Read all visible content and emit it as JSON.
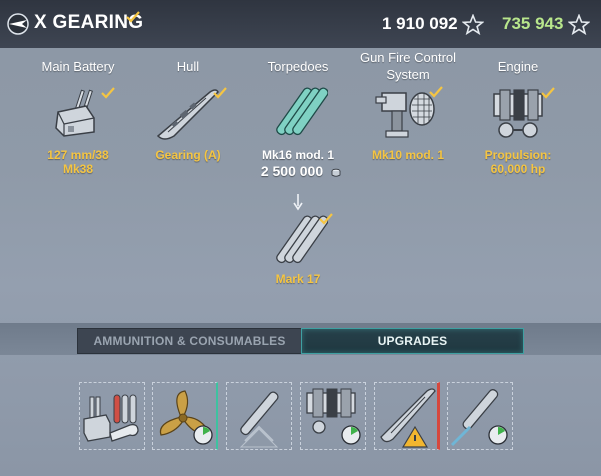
{
  "header": {
    "ship_title": "X GEARING",
    "xp_value": "1 910 092",
    "free_xp_value": "735 943",
    "colors": {
      "free_xp": "#b8e68c",
      "researched": "#f5c542"
    },
    "icons": [
      "nation-flag-icon",
      "researched-check-icon",
      "star-icon",
      "star-icon"
    ]
  },
  "modules": {
    "main_battery": {
      "title": "Main Battery",
      "name_line1": "127 mm/38",
      "name_line2": "Mk38"
    },
    "hull": {
      "title": "Hull",
      "name_line1": "Gearing (A)"
    },
    "torpedoes": {
      "title": "Torpedoes",
      "name_line1": "Mk16 mod. 1",
      "price": "2 500 000"
    },
    "gun_fire_control": {
      "title_line1": "Gun Fire Control",
      "title_line2": "System",
      "name_line1": "Mk10 mod. 1"
    },
    "engine": {
      "title": "Engine",
      "name_line1": "Propulsion:",
      "name_line2": "60,000 hp"
    },
    "torpedoes_upgrade": {
      "name_line1": "Mark 17"
    }
  },
  "tabs": {
    "ammunition": "AMMUNITION & CONSUMABLES",
    "upgrades": "UPGRADES",
    "active": "upgrades"
  },
  "upgrade_slots": [
    {
      "icon": "main-battery-wrench-upgrade-icon"
    },
    {
      "icon": "propeller-upgrade-icon"
    },
    {
      "icon": "torpedo-upgrade-icon"
    },
    {
      "icon": "engine-upgrade-icon"
    },
    {
      "icon": "hull-warning-upgrade-icon"
    },
    {
      "icon": "torpedo-tube-upgrade-icon"
    }
  ]
}
